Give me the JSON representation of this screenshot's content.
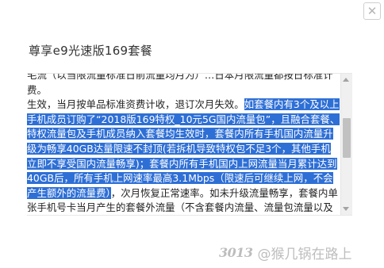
{
  "dialog": {
    "title": "尊享e9光速版169套餐",
    "close_icon": "close-icon"
  },
  "content": {
    "line_partial": "毛流（以当限流量标准日前流量均月为）…日本月限流量都按日标准计费。",
    "before_highlight": "生效，当月按单品标准资费计收，退订次月失效。",
    "highlight": "如套餐内有3个及以上手机成员订购了“2018版169特权_10元5G国内流量包”，且融合套餐、特权流量包及手机成员纳入套餐均生效时，套餐内所有手机国内流量升级为畅享40GB达量限速不封顶(若拆机导致特权包不足3个，其他手机立即不享受国内流量畅享)；套餐内所有手机国内上网流量当月累计达到40GB后，所有手机上网速率最高3.1Mbps（限速后可继续上网，不会产生额外的流量费）",
    "after_highlight": "，次月恢复正常速率。如未升级流量畅享，套餐内单张手机号卡当月产生的套餐外流量（不含套餐内流量、流量包流量以及赠送流量）累计达到封顶值15GB时，暂停当月手机上网服务，次月1日自动恢复开通，套餐包含"
  },
  "watermark": {
    "logo_text": "3013",
    "handle": "@猴几锅在路上"
  }
}
